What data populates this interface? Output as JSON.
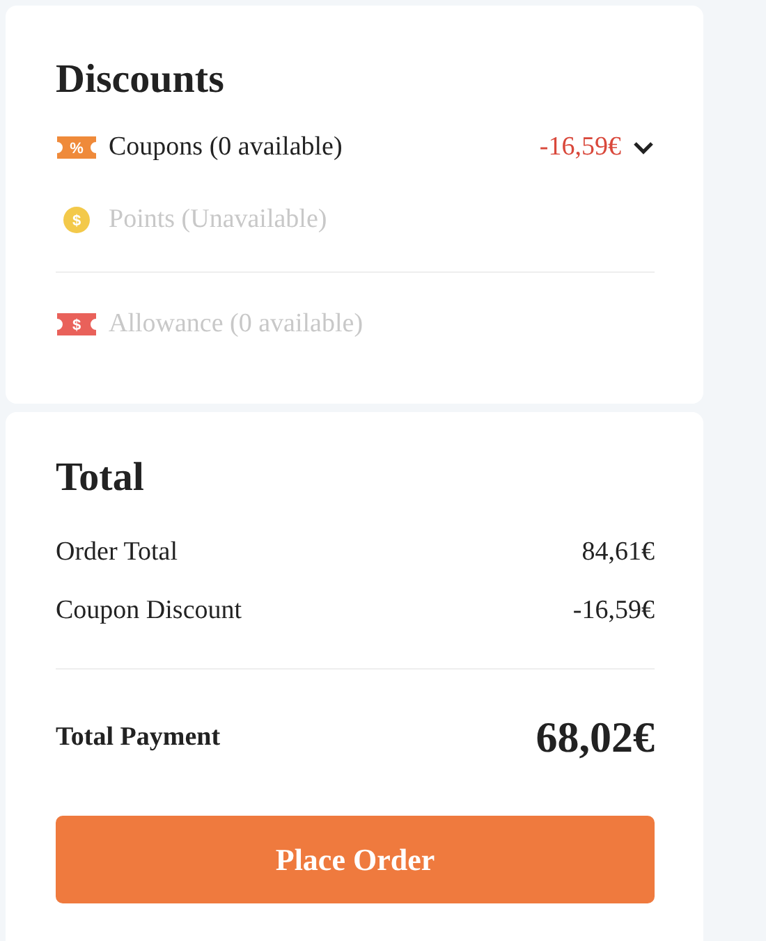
{
  "discounts": {
    "title": "Discounts",
    "items": [
      {
        "kind": "coupon",
        "icon_text": "%",
        "label": "Coupons (0 available)",
        "amount": "-16,59€",
        "disabled": false,
        "expandable": true
      },
      {
        "kind": "points",
        "icon_text": "$",
        "label": "Points (Unavailable)",
        "disabled": true,
        "expandable": false
      },
      {
        "kind": "allowance",
        "icon_text": "$",
        "label": "Allowance (0 available)",
        "disabled": true,
        "expandable": false
      }
    ]
  },
  "total": {
    "title": "Total",
    "lines": [
      {
        "label": "Order Total",
        "value": "84,61€"
      },
      {
        "label": "Coupon Discount",
        "value": "-16,59€"
      }
    ],
    "payment": {
      "label": "Total Payment",
      "value": "68,02€"
    },
    "button": "Place Order"
  }
}
